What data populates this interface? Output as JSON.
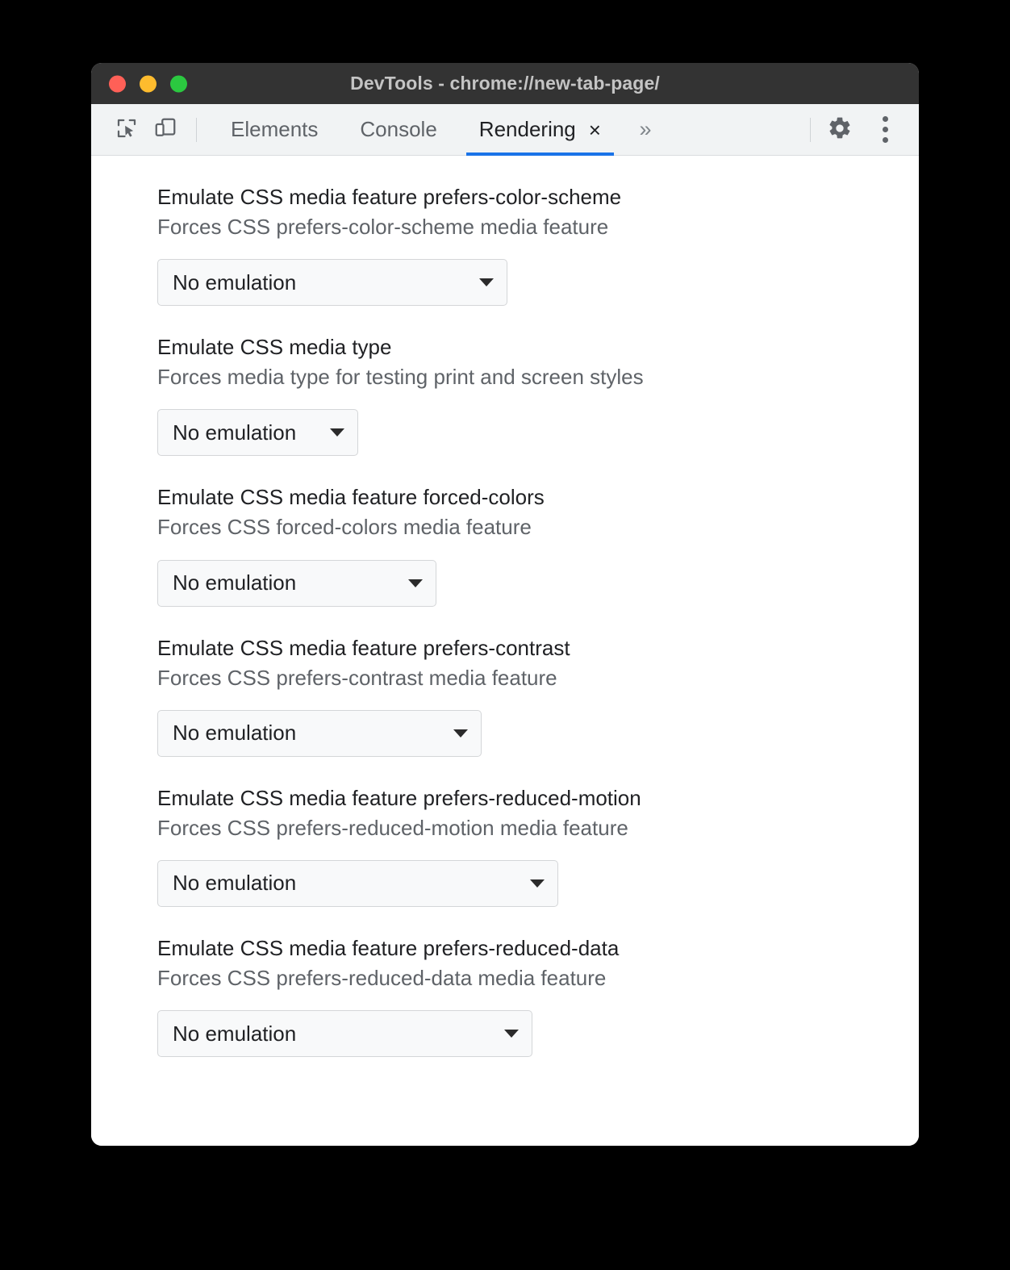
{
  "window": {
    "title": "DevTools - chrome://new-tab-page/",
    "traffic_lights": [
      {
        "name": "close",
        "color": "#ff6057"
      },
      {
        "name": "minimize",
        "color": "#febc2e"
      },
      {
        "name": "maximize",
        "color": "#2bc840"
      }
    ]
  },
  "toolbar": {
    "inspect_icon": "inspect-element-icon",
    "device_icon": "device-toolbar-icon",
    "more_tabs_label": "»",
    "settings_icon": "gear-icon",
    "menu_icon": "more-vertical-icon",
    "accent_color": "#1a73e8",
    "tabs": [
      {
        "label": "Elements",
        "active": false,
        "closable": false
      },
      {
        "label": "Console",
        "active": false,
        "closable": false
      },
      {
        "label": "Rendering",
        "active": true,
        "closable": true,
        "close_label": "×"
      }
    ]
  },
  "panel": {
    "settings": [
      {
        "title": "Emulate CSS media feature prefers-color-scheme",
        "description": "Forces CSS prefers-color-scheme media feature",
        "select_value": "No emulation",
        "select_width": 434
      },
      {
        "title": "Emulate CSS media type",
        "description": "Forces media type for testing print and screen styles",
        "select_value": "No emulation",
        "select_width": 249
      },
      {
        "title": "Emulate CSS media feature forced-colors",
        "description": "Forces CSS forced-colors media feature",
        "select_value": "No emulation",
        "select_width": 346
      },
      {
        "title": "Emulate CSS media feature prefers-contrast",
        "description": "Forces CSS prefers-contrast media feature",
        "select_value": "No emulation",
        "select_width": 402
      },
      {
        "title": "Emulate CSS media feature prefers-reduced-motion",
        "description": "Forces CSS prefers-reduced-motion media feature",
        "select_value": "No emulation",
        "select_width": 497
      },
      {
        "title": "Emulate CSS media feature prefers-reduced-data",
        "description": "Forces CSS prefers-reduced-data media feature",
        "select_value": "No emulation",
        "select_width": 465
      }
    ]
  }
}
